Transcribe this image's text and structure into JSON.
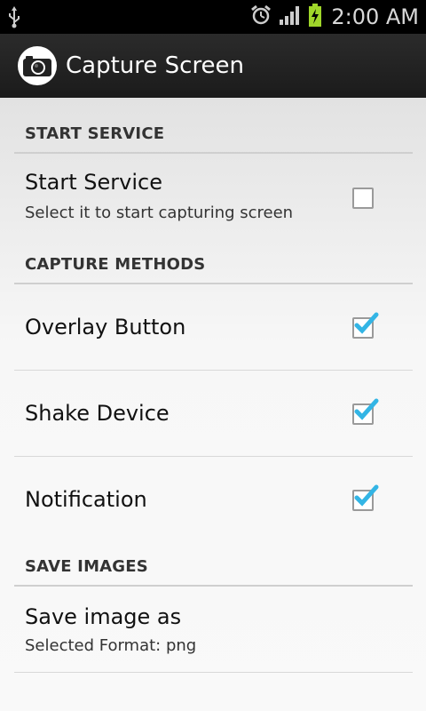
{
  "status_bar": {
    "time": "2:00 AM",
    "icons": [
      "usb-icon",
      "alarm-icon",
      "signal-icon",
      "battery-charging-icon"
    ]
  },
  "action_bar": {
    "app_icon": "camera-icon",
    "title": "Capture Screen"
  },
  "sections": [
    {
      "header": "START SERVICE",
      "items": [
        {
          "title": "Start Service",
          "summary": "Select it to start capturing screen",
          "checked": false
        }
      ]
    },
    {
      "header": "CAPTURE METHODS",
      "items": [
        {
          "title": "Overlay Button",
          "checked": true
        },
        {
          "title": "Shake Device",
          "checked": true
        },
        {
          "title": "Notification",
          "checked": true
        }
      ]
    },
    {
      "header": "SAVE IMAGES",
      "items": [
        {
          "title": "Save image as",
          "summary": "Selected Format: png"
        }
      ]
    }
  ],
  "colors": {
    "check_blue": "#33b5e5",
    "action_bar": "#1e1e1e",
    "status_bar": "#000000"
  }
}
